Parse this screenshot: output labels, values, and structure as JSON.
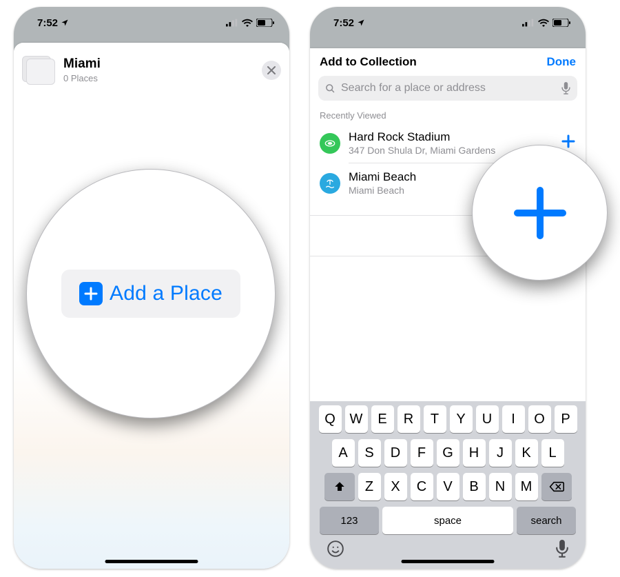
{
  "status": {
    "time": "7:52"
  },
  "left": {
    "collection_title": "Miami",
    "collection_sub": "0 Places",
    "add_place_label": "Add a Place"
  },
  "right": {
    "title": "Add to Collection",
    "done": "Done",
    "search_placeholder": "Search for a place or address",
    "section_label": "Recently Viewed",
    "items": [
      {
        "icon": "stadium",
        "title": "Hard Rock Stadium",
        "sub": "347 Don Shula Dr, Miami Gardens"
      },
      {
        "icon": "beach",
        "title": "Miami Beach",
        "sub": "Miami Beach"
      }
    ]
  },
  "keyboard": {
    "row1": [
      "Q",
      "W",
      "E",
      "R",
      "T",
      "Y",
      "U",
      "I",
      "O",
      "P"
    ],
    "row2": [
      "A",
      "S",
      "D",
      "F",
      "G",
      "H",
      "J",
      "K",
      "L"
    ],
    "row3": [
      "Z",
      "X",
      "C",
      "V",
      "B",
      "N",
      "M"
    ],
    "num": "123",
    "space": "space",
    "search": "search"
  }
}
